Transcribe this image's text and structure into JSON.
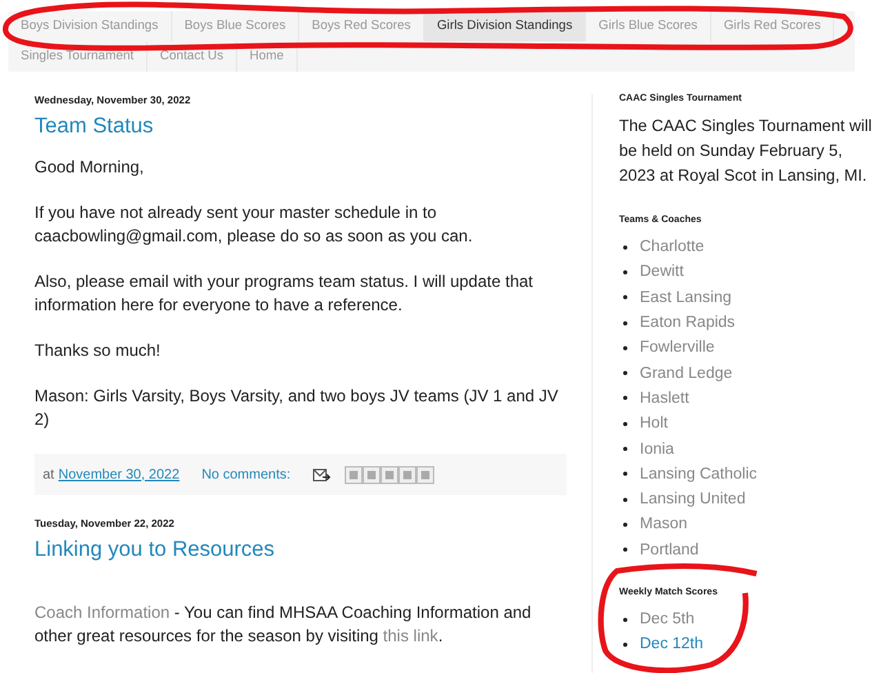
{
  "nav": {
    "circled": true,
    "tabs": [
      {
        "label": "Boys Division Standings",
        "selected": false
      },
      {
        "label": "Boys Blue Scores",
        "selected": false
      },
      {
        "label": "Boys Red Scores",
        "selected": false
      },
      {
        "label": "Girls Division Standings",
        "selected": true
      },
      {
        "label": "Girls Blue Scores",
        "selected": false
      },
      {
        "label": "Girls Red Scores",
        "selected": false
      },
      {
        "label": "Singles Tournament",
        "selected": false
      },
      {
        "label": "Contact Us",
        "selected": false
      },
      {
        "label": "Home",
        "selected": false
      }
    ]
  },
  "posts": [
    {
      "date": "Wednesday, November 30, 2022",
      "title": "Team Status",
      "paragraphs": [
        " Good Morning,",
        "If you have not already sent your master schedule in to caacbowling@gmail.com, please do so as soon as you can.",
        "Also, please email with your programs team status. I will update that information here for everyone to have a reference.",
        "Thanks so much!",
        "Mason:  Girls Varsity, Boys Varsity, and two boys JV teams (JV 1 and JV 2)"
      ],
      "footer": {
        "at": "at",
        "time": "November 30, 2022",
        "comments": "No comments:"
      }
    },
    {
      "date": "Tuesday, November 22, 2022",
      "title": "Linking you to Resources",
      "intro": {
        "link": "Coach Information",
        "text": " - You can find MHSAA Coaching Information and other great resources for the season by visiting ",
        "link2": "this link",
        "end": "."
      }
    }
  ],
  "sidebar": {
    "tournament": {
      "heading": "CAAC Singles Tournament",
      "text": "The CAAC Singles Tournament will be held on Sunday February 5, 2023 at Royal Scot in Lansing, MI."
    },
    "teams": {
      "heading": "Teams & Coaches",
      "items": [
        {
          "label": "Charlotte",
          "visited": true
        },
        {
          "label": "Dewitt",
          "visited": true
        },
        {
          "label": "East Lansing",
          "visited": true
        },
        {
          "label": "Eaton Rapids",
          "visited": true
        },
        {
          "label": "Fowlerville",
          "visited": true
        },
        {
          "label": "Grand Ledge",
          "visited": true
        },
        {
          "label": "Haslett",
          "visited": true
        },
        {
          "label": "Holt",
          "visited": true
        },
        {
          "label": "Ionia",
          "visited": true
        },
        {
          "label": "Lansing Catholic",
          "visited": true
        },
        {
          "label": "Lansing United",
          "visited": true
        },
        {
          "label": "Mason",
          "visited": true
        },
        {
          "label": "Portland",
          "visited": true
        }
      ]
    },
    "weekly": {
      "circled": true,
      "heading": "Weekly Match Scores",
      "items": [
        {
          "label": "Dec 5th",
          "visited": true
        },
        {
          "label": "Dec 12th",
          "visited": false
        }
      ]
    }
  }
}
